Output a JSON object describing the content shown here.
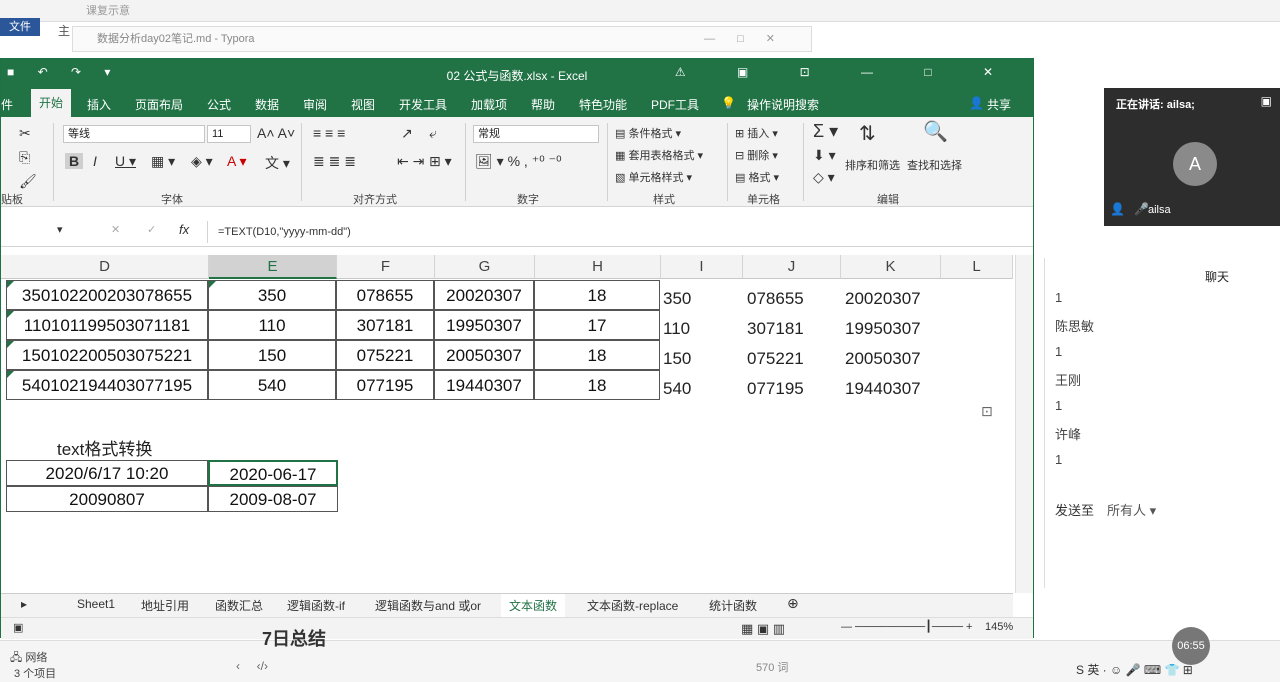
{
  "background": {
    "explorer_hint": "课复示意",
    "file_tab": "文件",
    "side_char": "主",
    "typora_title": "数据分析day02笔记.md - Typora",
    "bottom_net": "网络",
    "bottom_items": "3 个项目",
    "typora_words": "570 词",
    "heading_fragment": "7日总结"
  },
  "excel": {
    "title": "02 公式与函数.xlsx  -  Excel",
    "menu": [
      "件",
      "开始",
      "插入",
      "页面布局",
      "公式",
      "数据",
      "审阅",
      "视图",
      "开发工具",
      "加载项",
      "帮助",
      "特色功能",
      "PDF工具",
      "操作说明搜索",
      "共享"
    ],
    "ribbon": {
      "font_name": "等线",
      "font_size": "11",
      "number_format": "常规",
      "cond_format": "条件格式",
      "table_format": "套用表格格式",
      "cell_style": "单元格样式",
      "insert": "插入",
      "delete": "删除",
      "format": "格式",
      "sort_filter": "排序和筛选",
      "find_select": "查找和选择",
      "groups": [
        "贴板",
        "字体",
        "对齐方式",
        "数字",
        "样式",
        "单元格",
        "编辑"
      ]
    },
    "formula": "=TEXT(D10,\"yyyy-mm-dd\")",
    "columns": [
      "D",
      "E",
      "F",
      "G",
      "H",
      "I",
      "J",
      "K",
      "L"
    ],
    "rows": [
      {
        "d": "350102200203078655",
        "e": "350",
        "f": "078655",
        "g": "20020307",
        "h": "18",
        "i": "350",
        "j": "078655",
        "k": "20020307"
      },
      {
        "d": "110101199503071181",
        "e": "110",
        "f": "307181",
        "g": "19950307",
        "h": "17",
        "i": "110",
        "j": "307181",
        "k": "19950307"
      },
      {
        "d": "150102200503075221",
        "e": "150",
        "f": "075221",
        "g": "20050307",
        "h": "18",
        "i": "150",
        "j": "075221",
        "k": "20050307"
      },
      {
        "d": "540102194403077195",
        "e": "540",
        "f": "077195",
        "g": "19440307",
        "h": "18",
        "i": "540",
        "j": "077195",
        "k": "19440307"
      }
    ],
    "section_label": "text格式转换",
    "conv": [
      {
        "src": "2020/6/17 10:20",
        "out": "2020-06-17"
      },
      {
        "src": "20090807",
        "out": "2009-08-07"
      }
    ],
    "sheets": [
      "Sheet1",
      "地址引用",
      "函数汇总",
      "逻辑函数-if",
      "逻辑函数与and 或or",
      "文本函数",
      "文本函数-replace",
      "统计函数"
    ],
    "zoom": "145%"
  },
  "meeting": {
    "speaking": "正在讲话: ailsa;",
    "avatar_letter": "A",
    "name": "ailsa",
    "chat_title": "聊天",
    "messages": [
      "1",
      "陈思敏",
      "1",
      "王刚",
      "1",
      "许峰",
      "1"
    ],
    "send_to_label": "发送至",
    "send_to_value": "所有人",
    "time": "06:55"
  }
}
